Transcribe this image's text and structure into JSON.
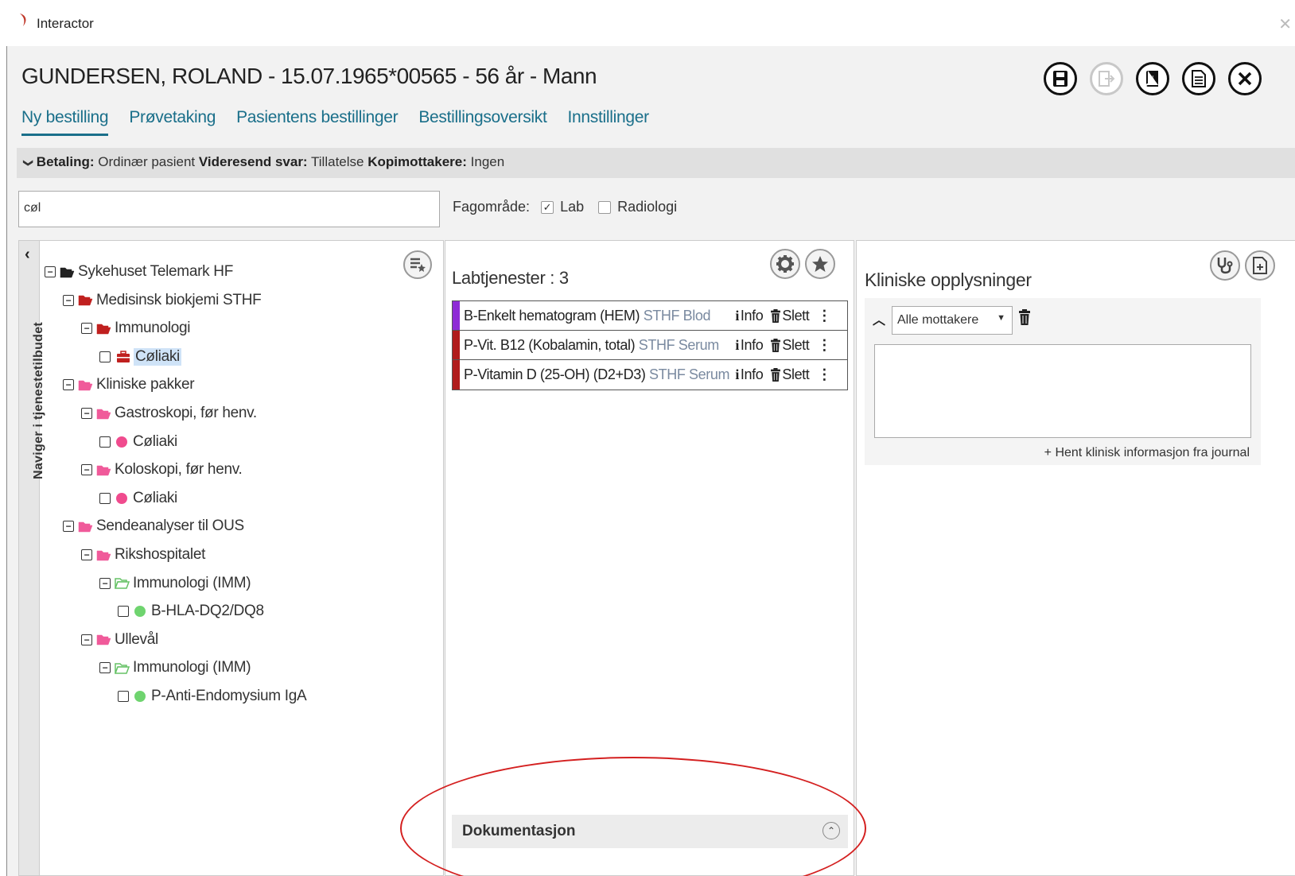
{
  "app": {
    "title": "Interactor",
    "logo_color": "#c0392b"
  },
  "patient": {
    "header": "GUNDERSEN, ROLAND - 15.07.1965*00565 - 56 år - Mann"
  },
  "header_buttons": [
    {
      "name": "save-icon",
      "enabled": true
    },
    {
      "name": "export-icon",
      "enabled": false
    },
    {
      "name": "book-icon",
      "enabled": true
    },
    {
      "name": "document-icon",
      "enabled": true
    },
    {
      "name": "close-icon",
      "enabled": true
    }
  ],
  "nav": {
    "tabs": [
      {
        "label": "Ny bestilling",
        "active": true
      },
      {
        "label": "Prøvetaking",
        "active": false
      },
      {
        "label": "Pasientens bestillinger",
        "active": false
      },
      {
        "label": "Bestillingsoversikt",
        "active": false
      },
      {
        "label": "Innstillinger",
        "active": false
      }
    ],
    "accent": "#1a6f8a"
  },
  "infobar": {
    "chevron": "❯",
    "betaling_label": "Betaling:",
    "betaling_value": "Ordinær pasient",
    "videresend_label": "Videresend svar:",
    "videresend_value": "Tillatelse",
    "kopi_label": "Kopimottakere:",
    "kopi_value": "Ingen"
  },
  "search": {
    "value": "cøl"
  },
  "fagomrade": {
    "label": "Fagområde:",
    "options": [
      {
        "label": "Lab",
        "checked": true
      },
      {
        "label": "Radiologi",
        "checked": false
      }
    ]
  },
  "tree": {
    "side_tab_label": "Naviger i tjenestetilbudet",
    "nodes": [
      {
        "label": "Sykehuset Telemark HF",
        "type": "folder",
        "color": "#222222"
      },
      {
        "label": "Medisinsk biokjemi STHF",
        "type": "folder",
        "color": "#c0201f"
      },
      {
        "label": "Immunologi",
        "type": "folder",
        "color": "#c0201f"
      },
      {
        "label": "Cøliaki",
        "type": "kit",
        "color": "#c0201f",
        "selected": true
      },
      {
        "label": "Kliniske pakker",
        "type": "folder",
        "color": "#f05a9a"
      },
      {
        "label": "Gastroskopi, før henv.",
        "type": "folder",
        "color": "#f05a9a"
      },
      {
        "label": "Cøliaki",
        "type": "dot",
        "color": "#f04b8e"
      },
      {
        "label": "Koloskopi, før henv.",
        "type": "folder",
        "color": "#f05a9a"
      },
      {
        "label": "Cøliaki",
        "type": "dot",
        "color": "#f04b8e"
      },
      {
        "label": "Sendeanalyser til OUS",
        "type": "folder",
        "color": "#f05a9a"
      },
      {
        "label": "Rikshospitalet",
        "type": "folder",
        "color": "#f05a9a"
      },
      {
        "label": "Immunologi (IMM)",
        "type": "folder-open",
        "color": "#66c266"
      },
      {
        "label": "B-HLA-DQ2/DQ8",
        "type": "dot",
        "color": "#6fd46f"
      },
      {
        "label": "Ullevål",
        "type": "folder",
        "color": "#f05a9a"
      },
      {
        "label": "Immunologi (IMM)",
        "type": "folder-open",
        "color": "#66c266"
      },
      {
        "label": "P-Anti-Endomysium IgA",
        "type": "dot",
        "color": "#6fd46f"
      }
    ]
  },
  "labtjenester": {
    "title": "Labtjenester : 3",
    "info_label": "Info",
    "delete_label": "Slett",
    "items": [
      {
        "name": "B-Enkelt hematogram (HEM)",
        "sub": "STHF Blod",
        "color": "#8e2bd6"
      },
      {
        "name": "P-Vit. B12 (Kobalamin, total)",
        "sub": "STHF Serum",
        "color": "#b01c1c"
      },
      {
        "name": "P-Vitamin D (25-OH) (D2+D3)",
        "sub": "STHF Serum",
        "color": "#b01c1c"
      }
    ],
    "dokumentasjon": "Dokumentasjon"
  },
  "kliniske": {
    "title": "Kliniske opplysninger",
    "recipient": "Alle mottakere",
    "hent_link": "+ Hent klinisk informasjon fra journal"
  },
  "annotation_color": "#d42020"
}
